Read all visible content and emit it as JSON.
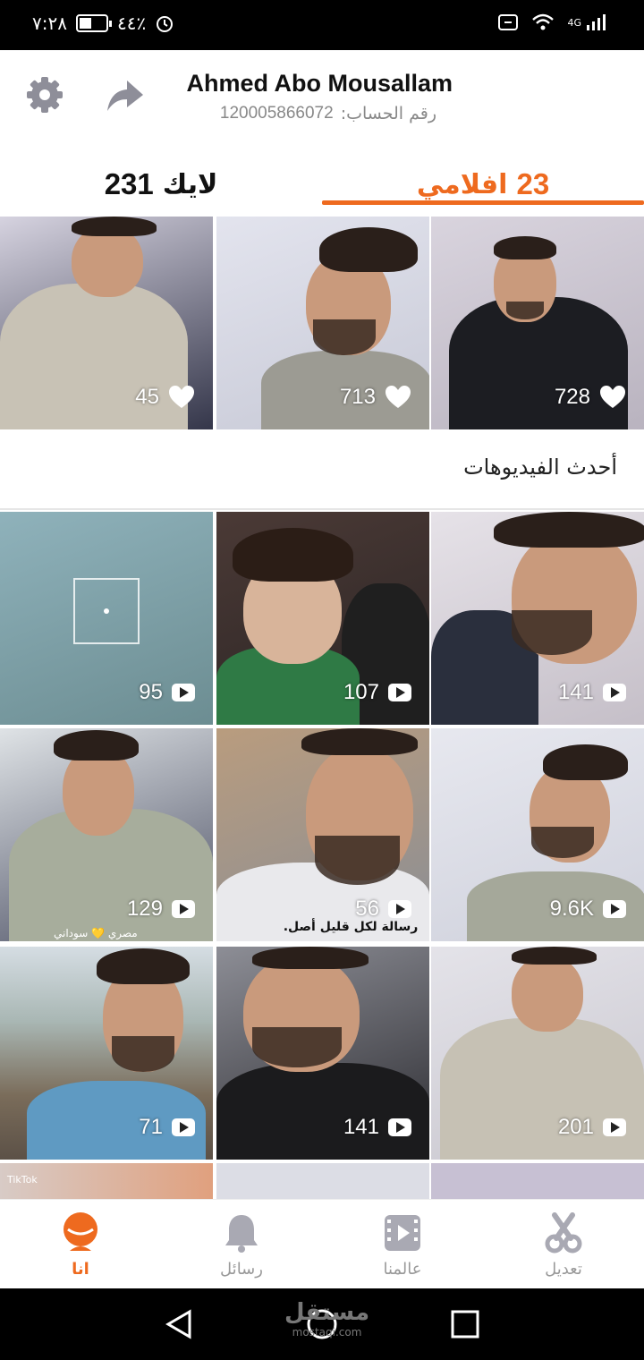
{
  "status": {
    "time": "٧:٢٨",
    "battery": "٤٤٪",
    "network": "4G"
  },
  "profile": {
    "name": "Ahmed Abo Mousallam",
    "account_label": "رقم الحساب:",
    "account_number": "120005866072"
  },
  "tabs": {
    "videos_count": "23",
    "videos_label": "افلامي",
    "likes_label": "لايك",
    "likes_count": "231"
  },
  "top_videos": [
    {
      "count": "728"
    },
    {
      "count": "713"
    },
    {
      "count": "45"
    }
  ],
  "section_title": "أحدث الفيديوهات",
  "recent_videos": [
    {
      "count": "141"
    },
    {
      "count": "107"
    },
    {
      "count": "95"
    },
    {
      "count": "9.6K"
    },
    {
      "count": "56"
    },
    {
      "count": "129"
    },
    {
      "count": "201"
    },
    {
      "count": "141"
    },
    {
      "count": "71"
    }
  ],
  "overlays": {
    "tile_caption": "رسالة لكل قليل أصل.",
    "tiktok": "TikTok",
    "country": "مصري 💛 سوداني"
  },
  "nav": {
    "me": "انا",
    "messages": "رسائل",
    "world": "عالمنا",
    "edit": "تعديل"
  },
  "watermark": {
    "text": "مستقل",
    "sub": "mostaqi.com"
  },
  "colors": {
    "accent": "#ee6a1f",
    "inactive": "#999999",
    "icon_gray": "#a9a9b3"
  }
}
